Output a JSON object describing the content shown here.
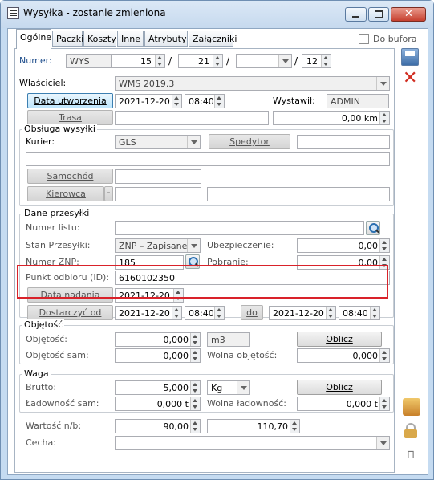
{
  "window": {
    "title": "Wysyłka - zostanie zmieniona"
  },
  "tabs": [
    "Ogólne",
    "Paczki",
    "Koszty",
    "Inne",
    "Atrybuty",
    "Załączniki"
  ],
  "do_bufora": "Do bufora",
  "numer": {
    "label": "Numer:",
    "prefix": "WYS",
    "n1": "15",
    "n2": "21",
    "n3": "",
    "n4": "12"
  },
  "wlasciciel": {
    "label": "Właściciel:",
    "value": "WMS 2019.3"
  },
  "data_utworzenia": {
    "button": "Data utworzenia",
    "date": "2021-12-20",
    "time": "08:40"
  },
  "wystawil": {
    "label": "Wystawił:",
    "value": "ADMIN"
  },
  "trasa": {
    "button": "Trasa",
    "value": "",
    "distance": "0,00 km"
  },
  "obsluga": {
    "legend": "Obsługa wysyłki",
    "kurier_label": "Kurier:",
    "kurier_value": "GLS",
    "spedytor_button": "Spedytor",
    "spedytor_value": "",
    "samochod_button": "Samochód",
    "kierowca_button": "Kierowca"
  },
  "dane": {
    "legend": "Dane przesyłki",
    "numer_listu_label": "Numer listu:",
    "stan_label": "Stan Przesyłki:",
    "stan_value": "ZNP – Zapisane",
    "ubezpieczenie_label": "Ubezpieczenie:",
    "ubezpieczenie_value": "0,00",
    "numer_znp_label": "Numer ZNP:",
    "numer_znp_value": "185",
    "pobranie_label": "Pobranie:",
    "pobranie_value": "0,00",
    "punkt_label": "Punkt odbioru (ID):",
    "punkt_value": "6160102350",
    "data_nadania_button": "Data nadania",
    "data_nadania_value": "2021-12-20",
    "dostarczyc_button": "Dostarczyć od",
    "od_date": "2021-12-20",
    "od_time": "08:40",
    "do_button": "do",
    "do_date": "2021-12-20",
    "do_time": "08:40"
  },
  "objetosc": {
    "legend": "Objętość",
    "objetosc_label": "Objętość:",
    "objetosc_value": "0,000",
    "unit": "m3",
    "oblicz": "Oblicz",
    "sam_label": "Objętość sam:",
    "sam_value": "0,000",
    "wolna_label": "Wolna objętość:",
    "wolna_value": "0,000"
  },
  "waga": {
    "legend": "Waga",
    "brutto_label": "Brutto:",
    "brutto_value": "5,000",
    "unit": "Kg",
    "oblicz": "Oblicz",
    "ladownosc_label": "Ładowność sam:",
    "ladownosc_value": "0,000 t",
    "wolna_label": "Wolna ładowność:",
    "wolna_value": "0,000 t"
  },
  "wartosc": {
    "label": "Wartość n/b:",
    "netto": "90,00",
    "brutto": "110,70"
  },
  "cecha": {
    "label": "Cecha:",
    "value": ""
  },
  "colors": {
    "highlight": "#d9222a",
    "window": "#c5dbf1"
  }
}
